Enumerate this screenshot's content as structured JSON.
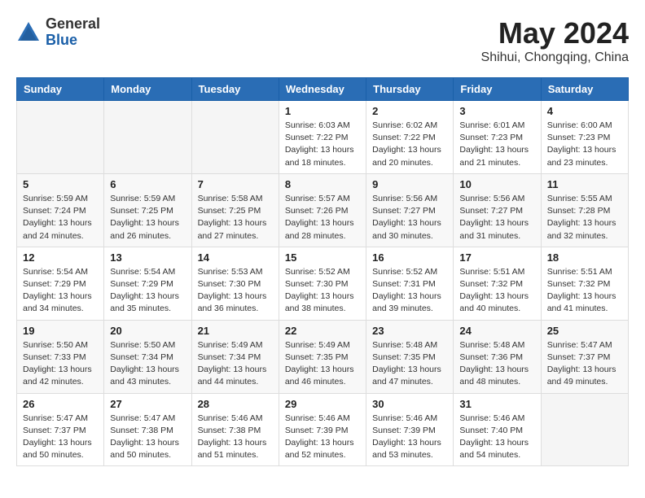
{
  "header": {
    "logo_general": "General",
    "logo_blue": "Blue",
    "month": "May 2024",
    "location": "Shihui, Chongqing, China"
  },
  "weekdays": [
    "Sunday",
    "Monday",
    "Tuesday",
    "Wednesday",
    "Thursday",
    "Friday",
    "Saturday"
  ],
  "weeks": [
    [
      {
        "day": "",
        "info": ""
      },
      {
        "day": "",
        "info": ""
      },
      {
        "day": "",
        "info": ""
      },
      {
        "day": "1",
        "info": "Sunrise: 6:03 AM\nSunset: 7:22 PM\nDaylight: 13 hours\nand 18 minutes."
      },
      {
        "day": "2",
        "info": "Sunrise: 6:02 AM\nSunset: 7:22 PM\nDaylight: 13 hours\nand 20 minutes."
      },
      {
        "day": "3",
        "info": "Sunrise: 6:01 AM\nSunset: 7:23 PM\nDaylight: 13 hours\nand 21 minutes."
      },
      {
        "day": "4",
        "info": "Sunrise: 6:00 AM\nSunset: 7:23 PM\nDaylight: 13 hours\nand 23 minutes."
      }
    ],
    [
      {
        "day": "5",
        "info": "Sunrise: 5:59 AM\nSunset: 7:24 PM\nDaylight: 13 hours\nand 24 minutes."
      },
      {
        "day": "6",
        "info": "Sunrise: 5:59 AM\nSunset: 7:25 PM\nDaylight: 13 hours\nand 26 minutes."
      },
      {
        "day": "7",
        "info": "Sunrise: 5:58 AM\nSunset: 7:25 PM\nDaylight: 13 hours\nand 27 minutes."
      },
      {
        "day": "8",
        "info": "Sunrise: 5:57 AM\nSunset: 7:26 PM\nDaylight: 13 hours\nand 28 minutes."
      },
      {
        "day": "9",
        "info": "Sunrise: 5:56 AM\nSunset: 7:27 PM\nDaylight: 13 hours\nand 30 minutes."
      },
      {
        "day": "10",
        "info": "Sunrise: 5:56 AM\nSunset: 7:27 PM\nDaylight: 13 hours\nand 31 minutes."
      },
      {
        "day": "11",
        "info": "Sunrise: 5:55 AM\nSunset: 7:28 PM\nDaylight: 13 hours\nand 32 minutes."
      }
    ],
    [
      {
        "day": "12",
        "info": "Sunrise: 5:54 AM\nSunset: 7:29 PM\nDaylight: 13 hours\nand 34 minutes."
      },
      {
        "day": "13",
        "info": "Sunrise: 5:54 AM\nSunset: 7:29 PM\nDaylight: 13 hours\nand 35 minutes."
      },
      {
        "day": "14",
        "info": "Sunrise: 5:53 AM\nSunset: 7:30 PM\nDaylight: 13 hours\nand 36 minutes."
      },
      {
        "day": "15",
        "info": "Sunrise: 5:52 AM\nSunset: 7:30 PM\nDaylight: 13 hours\nand 38 minutes."
      },
      {
        "day": "16",
        "info": "Sunrise: 5:52 AM\nSunset: 7:31 PM\nDaylight: 13 hours\nand 39 minutes."
      },
      {
        "day": "17",
        "info": "Sunrise: 5:51 AM\nSunset: 7:32 PM\nDaylight: 13 hours\nand 40 minutes."
      },
      {
        "day": "18",
        "info": "Sunrise: 5:51 AM\nSunset: 7:32 PM\nDaylight: 13 hours\nand 41 minutes."
      }
    ],
    [
      {
        "day": "19",
        "info": "Sunrise: 5:50 AM\nSunset: 7:33 PM\nDaylight: 13 hours\nand 42 minutes."
      },
      {
        "day": "20",
        "info": "Sunrise: 5:50 AM\nSunset: 7:34 PM\nDaylight: 13 hours\nand 43 minutes."
      },
      {
        "day": "21",
        "info": "Sunrise: 5:49 AM\nSunset: 7:34 PM\nDaylight: 13 hours\nand 44 minutes."
      },
      {
        "day": "22",
        "info": "Sunrise: 5:49 AM\nSunset: 7:35 PM\nDaylight: 13 hours\nand 46 minutes."
      },
      {
        "day": "23",
        "info": "Sunrise: 5:48 AM\nSunset: 7:35 PM\nDaylight: 13 hours\nand 47 minutes."
      },
      {
        "day": "24",
        "info": "Sunrise: 5:48 AM\nSunset: 7:36 PM\nDaylight: 13 hours\nand 48 minutes."
      },
      {
        "day": "25",
        "info": "Sunrise: 5:47 AM\nSunset: 7:37 PM\nDaylight: 13 hours\nand 49 minutes."
      }
    ],
    [
      {
        "day": "26",
        "info": "Sunrise: 5:47 AM\nSunset: 7:37 PM\nDaylight: 13 hours\nand 50 minutes."
      },
      {
        "day": "27",
        "info": "Sunrise: 5:47 AM\nSunset: 7:38 PM\nDaylight: 13 hours\nand 50 minutes."
      },
      {
        "day": "28",
        "info": "Sunrise: 5:46 AM\nSunset: 7:38 PM\nDaylight: 13 hours\nand 51 minutes."
      },
      {
        "day": "29",
        "info": "Sunrise: 5:46 AM\nSunset: 7:39 PM\nDaylight: 13 hours\nand 52 minutes."
      },
      {
        "day": "30",
        "info": "Sunrise: 5:46 AM\nSunset: 7:39 PM\nDaylight: 13 hours\nand 53 minutes."
      },
      {
        "day": "31",
        "info": "Sunrise: 5:46 AM\nSunset: 7:40 PM\nDaylight: 13 hours\nand 54 minutes."
      },
      {
        "day": "",
        "info": ""
      }
    ]
  ]
}
